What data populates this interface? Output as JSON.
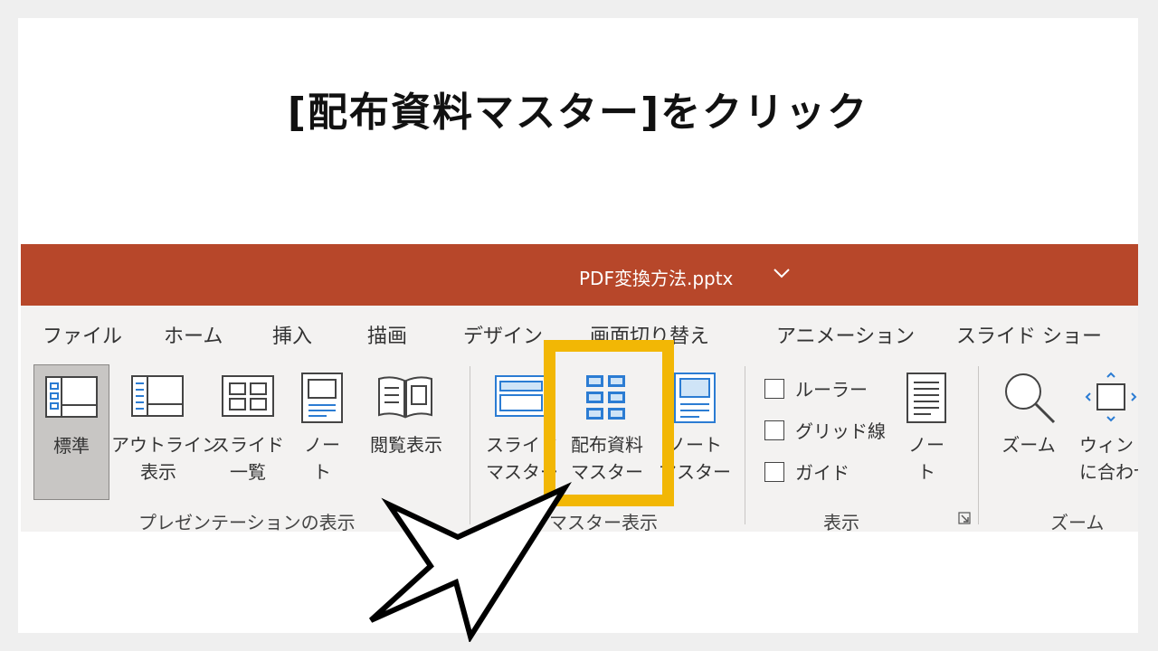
{
  "slide": {
    "title": "[配布資料マスター]をクリック"
  },
  "window": {
    "filename": "PDF変換方法.pptx",
    "title_bar_color": "#b7472a",
    "chevron": "∨"
  },
  "tabs": [
    "ファイル",
    "ホーム",
    "挿入",
    "描画",
    "デザイン",
    "画面切り替え",
    "アニメーション",
    "スライド ショー"
  ],
  "ribbon": {
    "presentation_views": {
      "group_label": "プレゼンテーションの表示",
      "buttons": [
        {
          "line1": "標準",
          "line2": "",
          "icon": "normal-view-icon",
          "selected": true
        },
        {
          "line1": "アウトライン",
          "line2": "表示",
          "icon": "outline-view-icon"
        },
        {
          "line1": "スライド",
          "line2": "一覧",
          "icon": "slide-sorter-icon"
        },
        {
          "line1": "ノー",
          "line2": "ト",
          "icon": "notes-page-icon"
        },
        {
          "line1": "閲覧表示",
          "line2": "",
          "icon": "reading-view-icon"
        }
      ]
    },
    "master_views": {
      "group_label": "マスター表示",
      "buttons": [
        {
          "line1": "スライド",
          "line2": "マスター",
          "icon": "slide-master-icon"
        },
        {
          "line1": "配布資料",
          "line2": "マスター",
          "icon": "handout-master-icon"
        },
        {
          "line1": "ノート",
          "line2": "マスター",
          "icon": "notes-master-icon"
        }
      ]
    },
    "show": {
      "group_label": "表示",
      "checkboxes": [
        {
          "label": "ルーラー",
          "checked": false
        },
        {
          "label": "グリッド線",
          "checked": false
        },
        {
          "label": "ガイド",
          "checked": false
        }
      ],
      "notes_button": {
        "line1": "ノー",
        "line2": "ト",
        "icon": "notes-icon"
      }
    },
    "zoom": {
      "group_label": "ズーム",
      "zoom_button": {
        "line1": "ズーム",
        "icon": "magnifier-icon"
      },
      "fit_button": {
        "line1": "ウィンド",
        "line2": "に合わせ",
        "icon": "fit-to-window-icon"
      }
    }
  },
  "highlight_color": "#f2b705"
}
